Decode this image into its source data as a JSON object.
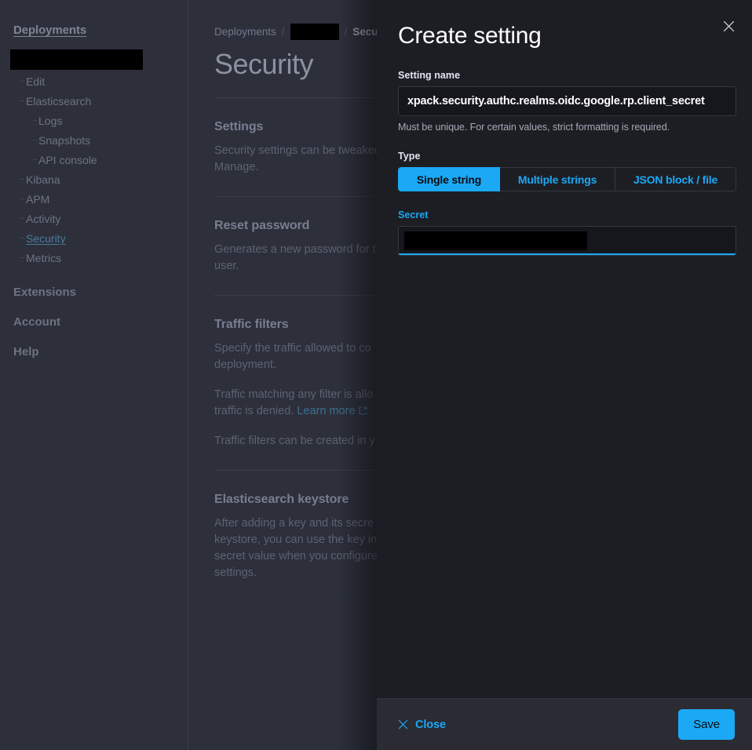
{
  "sidebar": {
    "top_link": "Deployments",
    "deployment_name_redacted": true,
    "items": [
      {
        "label": "Edit",
        "level": 1,
        "active": false
      },
      {
        "label": "Elasticsearch",
        "level": 1,
        "active": false
      },
      {
        "label": "Logs",
        "level": 2,
        "active": false
      },
      {
        "label": "Snapshots",
        "level": 2,
        "active": false
      },
      {
        "label": "API console",
        "level": 2,
        "active": false
      },
      {
        "label": "Kibana",
        "level": 1,
        "active": false
      },
      {
        "label": "APM",
        "level": 1,
        "active": false
      },
      {
        "label": "Activity",
        "level": 1,
        "active": false
      },
      {
        "label": "Security",
        "level": 1,
        "active": true
      },
      {
        "label": "Metrics",
        "level": 1,
        "active": false
      }
    ],
    "groups": [
      "Extensions",
      "Account",
      "Help"
    ]
  },
  "breadcrumb": {
    "first": "Deployments",
    "separator": "/",
    "redacted": true,
    "current": "Secu"
  },
  "page": {
    "title": "Security",
    "sections": [
      {
        "title": "Settings",
        "paragraphs": [
          "Security settings can be tweaked\nManage."
        ]
      },
      {
        "title": "Reset password",
        "paragraphs": [
          "Generates a new password for t\nuser."
        ]
      },
      {
        "title": "Traffic filters",
        "paragraphs": [
          "Specify the traffic allowed to co\ndeployment.",
          "Traffic matching any filter is allo\ntraffic is denied. ",
          "Traffic filters can be created in y"
        ],
        "link_text": "Learn more"
      },
      {
        "title": "Elasticsearch keystore",
        "paragraphs": [
          "After adding a key and its secre\nkeystore, you can use the key in\nsecret value when you configure\nsettings."
        ]
      }
    ]
  },
  "flyout": {
    "title": "Create setting",
    "close_icon": "close-icon",
    "setting_name": {
      "label": "Setting name",
      "value": "xpack.security.authc.realms.oidc.google.rp.client_secret",
      "help": "Must be unique. For certain values, strict formatting is required."
    },
    "type": {
      "label": "Type",
      "options": [
        "Single string",
        "Multiple strings",
        "JSON block / file"
      ],
      "selected": "Single string"
    },
    "secret": {
      "label": "Secret",
      "value_redacted": true,
      "focused": true
    },
    "footer": {
      "close_label": "Close",
      "save_label": "Save"
    }
  },
  "colors": {
    "accent": "#1ba9f5",
    "panel_bg": "#1d1e24",
    "footer_bg": "#2a2b33",
    "app_bg": "#2d303b",
    "link": "#3f6e91"
  }
}
